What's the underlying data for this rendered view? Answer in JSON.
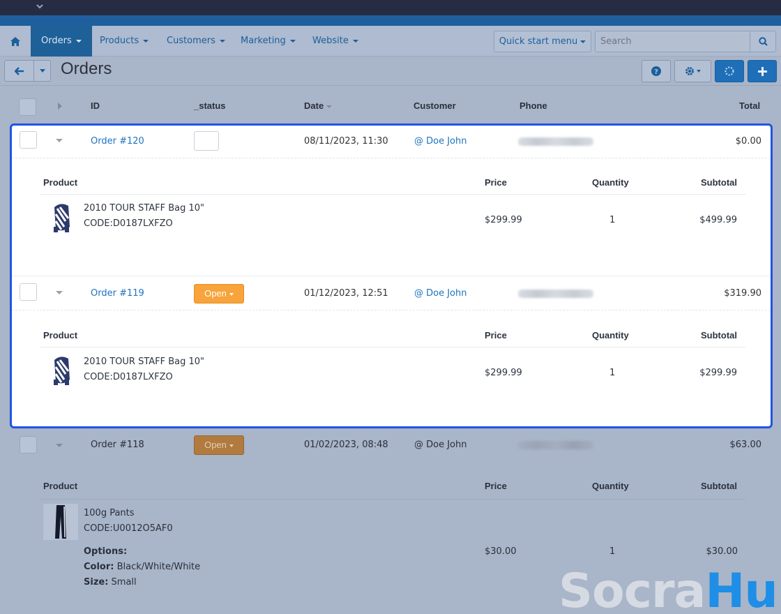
{
  "nav": {
    "items": [
      {
        "label": "Orders",
        "active": true
      },
      {
        "label": "Products",
        "active": false
      },
      {
        "label": "Customers",
        "active": false
      },
      {
        "label": "Marketing",
        "active": false
      },
      {
        "label": "Website",
        "active": false
      }
    ],
    "quick_start": "Quick start menu",
    "search_placeholder": "Search"
  },
  "page": {
    "title": "Orders"
  },
  "grid": {
    "headers": {
      "id": "ID",
      "status": "_status",
      "date": "Date",
      "customer": "Customer",
      "phone": "Phone",
      "total": "Total"
    },
    "detail_headers": {
      "product": "Product",
      "price": "Price",
      "quantity": "Quantity",
      "subtotal": "Subtotal"
    },
    "orders": [
      {
        "id": "Order #120",
        "status": "",
        "date": "08/11/2023, 11:30",
        "customer": "@ Doe John",
        "total": "$0.00",
        "items": [
          {
            "name": "2010 TOUR STAFF Bag 10\"",
            "code": "CODE:D0187LXFZO",
            "price": "$299.99",
            "quantity": "1",
            "subtotal": "$499.99"
          }
        ]
      },
      {
        "id": "Order #119",
        "status": "Open",
        "date": "01/12/2023, 12:51",
        "customer": "@ Doe John",
        "total": "$319.90",
        "items": [
          {
            "name": "2010 TOUR STAFF Bag 10\"",
            "code": "CODE:D0187LXFZO",
            "price": "$299.99",
            "quantity": "1",
            "subtotal": "$299.99"
          }
        ]
      },
      {
        "id": "Order #118",
        "status": "Open",
        "date": "01/02/2023, 08:48",
        "customer": "@ Doe John",
        "total": "$63.00",
        "items": [
          {
            "name": "100g Pants",
            "code": "CODE:U0012O5AF0",
            "options_label": "Options:",
            "color_label": "Color:",
            "color_value": "Black/White/White",
            "size_label": "Size:",
            "size_value": "Small",
            "price": "$30.00",
            "quantity": "1",
            "subtotal": "$30.00"
          }
        ]
      }
    ]
  },
  "watermark": {
    "part1": "Socra",
    "part2": "Hub"
  },
  "colors": {
    "accent": "#1d74c0",
    "highlight_border": "#2253e6",
    "status_open": "#f8a33b",
    "primary_button": "#1f6fb8"
  }
}
